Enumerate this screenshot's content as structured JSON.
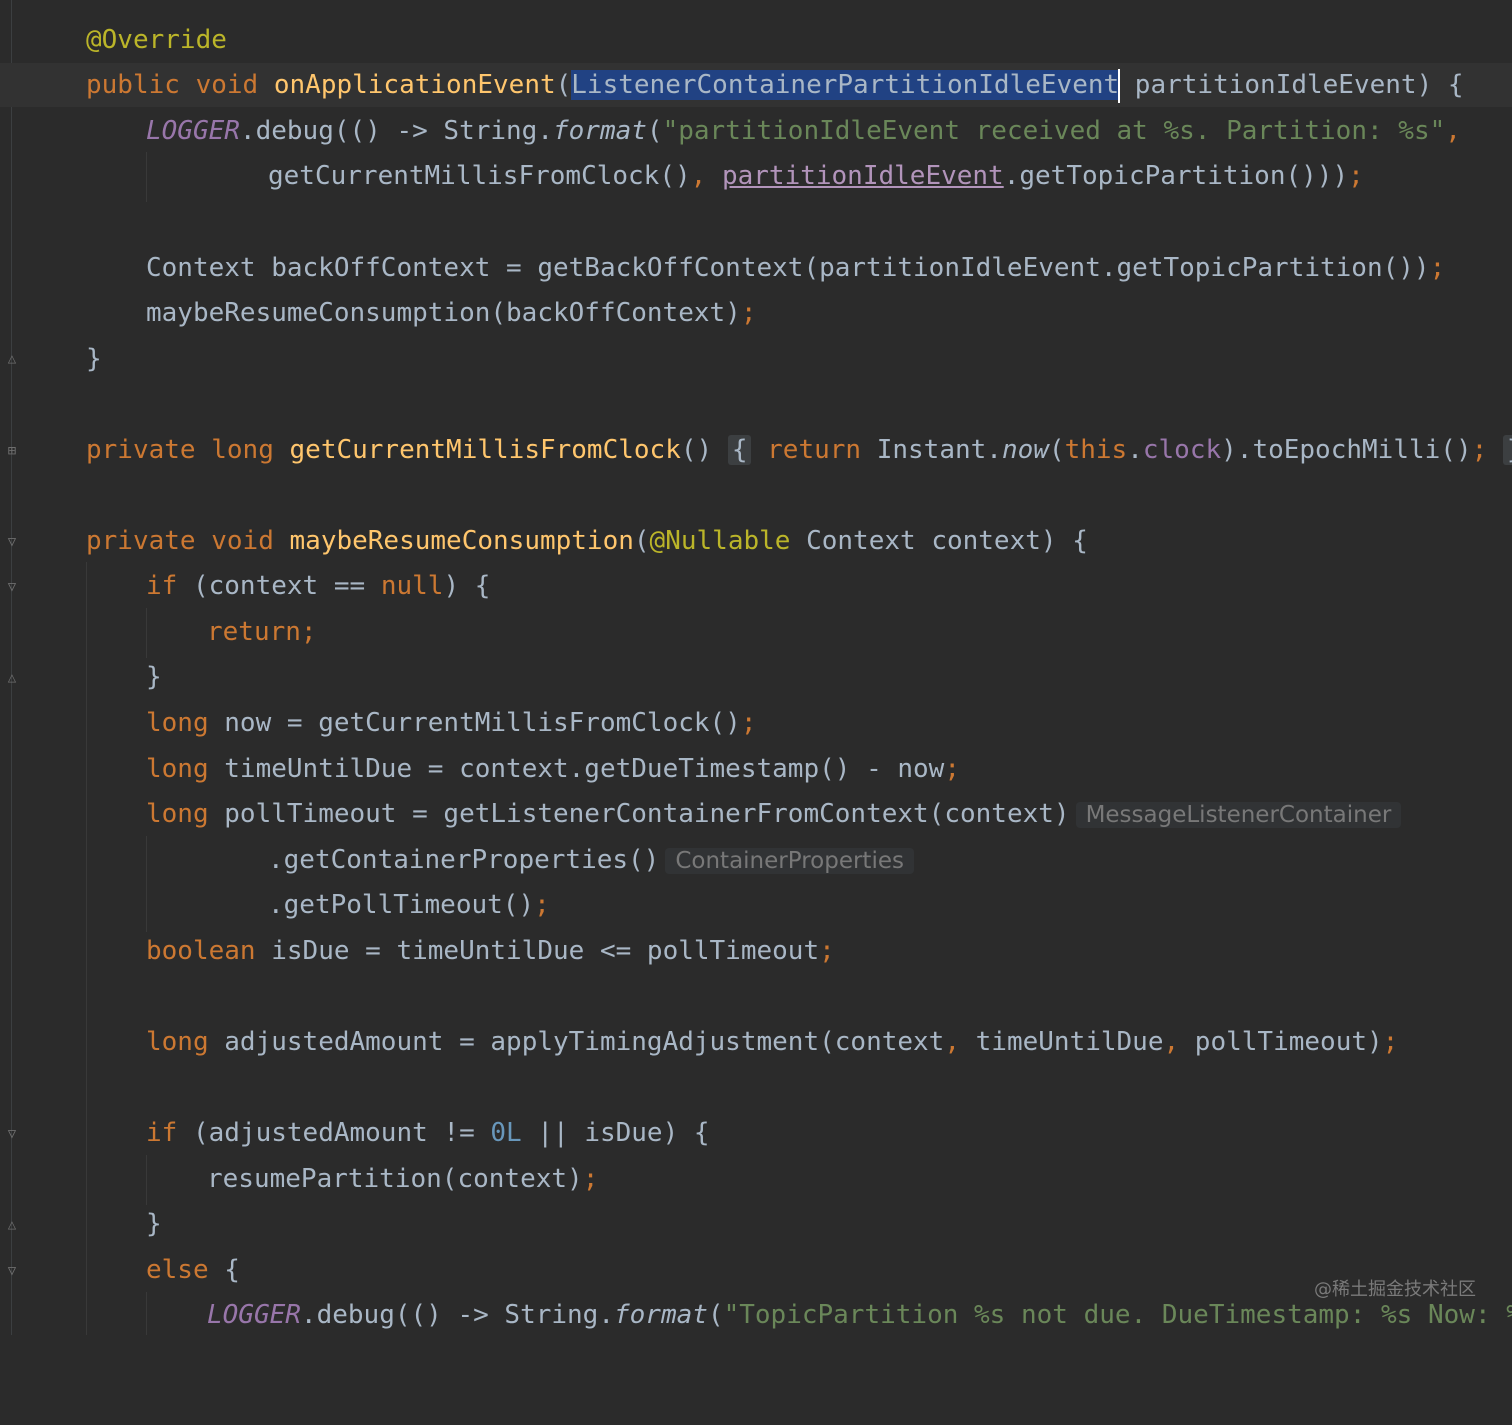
{
  "editor": {
    "colors": {
      "background": "#2b2b2b",
      "keyword": "#cc7832",
      "annotation": "#bbb529",
      "method_declaration": "#ffc66d",
      "string": "#6a8759",
      "field": "#9876aa",
      "number": "#6897bb",
      "selection": "#214283"
    },
    "lines": {
      "l1": {
        "annotation": "@Override"
      },
      "l2": {
        "kw1": "public",
        "kw2": "void",
        "fn": "onApplicationEvent",
        "open": "(",
        "selected_type": "ListenerContainerPartitionIdleEvent",
        "rest": " partitionIdleEvent) {"
      },
      "l3": {
        "static_field": "LOGGER",
        "p1": ".debug(() -> String.",
        "static_call": "format",
        "p2": "(",
        "str": "\"partitionIdleEvent received at %s. Partition: %s\"",
        "comma": ","
      },
      "l4": {
        "p1": "getCurrentMillisFromClock()",
        "comma": ",",
        "sp": " ",
        "link": "partitionIdleEvent",
        "p2": ".getTopicPartition()))",
        "semi": ";"
      },
      "l5": {
        "p1": "Context backOffContext = getBackOffContext(partitionIdleEvent.getTopicPartition())",
        "semi": ";"
      },
      "l6": {
        "p1": "maybeResumeConsumption(backOffContext)",
        "semi": ";"
      },
      "l7": {
        "p1": "}"
      },
      "l8": {
        "kw1": "private",
        "kw2": "long",
        "fn": "getCurrentMillisFromClock",
        "p1": "()",
        "fold_open": "{",
        "kw3": "return",
        "p2": " Instant.",
        "static_call": "now",
        "p3": "(",
        "kw4": "this",
        "p4": ".",
        "field": "clock",
        "p5": ").toEpochMilli()",
        "semi": ";",
        "fold_close": "}"
      },
      "l9": {
        "kw1": "private",
        "kw2": "void",
        "fn": "maybeResumeConsumption",
        "p1": "(",
        "ann": "@Nullable",
        "p2": " Context context) {"
      },
      "l10": {
        "kw1": "if",
        "p1": " (context == ",
        "kw2": "null",
        "p2": ") {"
      },
      "l11": {
        "kw1": "return",
        "semi": ";"
      },
      "l12": {
        "p1": "}"
      },
      "l13": {
        "kw1": "long",
        "p1": " now = getCurrentMillisFromClock()",
        "semi": ";"
      },
      "l14": {
        "kw1": "long",
        "p1": " timeUntilDue = context.getDueTimestamp() - now",
        "semi": ";"
      },
      "l15": {
        "kw1": "long",
        "p1": " pollTimeout = getListenerContainerFromContext(context)",
        "hint": "MessageListenerContainer"
      },
      "l16": {
        "p1": ".getContainerProperties()",
        "hint": "ContainerProperties"
      },
      "l17": {
        "p1": ".getPollTimeout()",
        "semi": ";"
      },
      "l18": {
        "kw1": "boolean",
        "p1": " isDue = timeUntilDue <= pollTimeout",
        "semi": ";"
      },
      "l19": {
        "kw1": "long",
        "p1": " adjustedAmount = applyTimingAdjustment(context",
        "c1": ",",
        "p2": " timeUntilDue",
        "c2": ",",
        "p3": " pollTimeout)",
        "semi": ";"
      },
      "l20": {
        "kw1": "if",
        "p1": " (adjustedAmount != ",
        "num": "0L",
        "p2": " || isDue) {"
      },
      "l21": {
        "p1": "resumePartition(context)",
        "semi": ";"
      },
      "l22": {
        "p1": "}"
      },
      "l23": {
        "kw1": "else",
        "p1": " {"
      },
      "l24": {
        "static_field": "LOGGER",
        "p1": ".debug(() -> String.",
        "static_call": "format",
        "p2": "(",
        "str": "\"TopicPartition %s not due. DueTimestamp: %s Now: %s"
      }
    }
  },
  "watermark": "@稀土掘金技术社区"
}
